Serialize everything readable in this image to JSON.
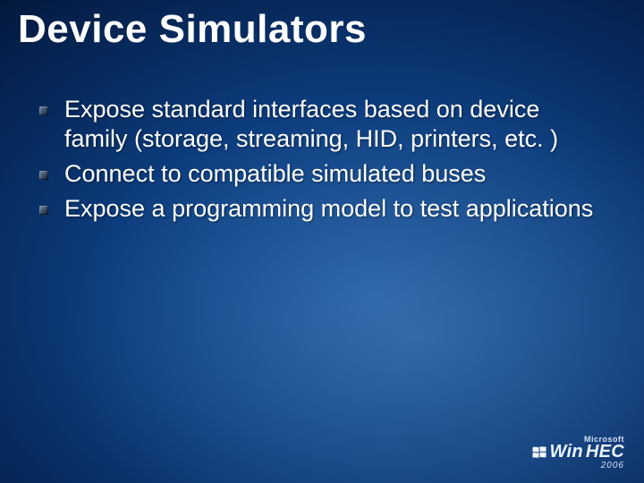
{
  "title": "Device Simulators",
  "bullets": [
    "Expose standard interfaces based on device family (storage, streaming, HID, printers, etc. )",
    "Connect to compatible simulated buses",
    "Expose a programming model to test applications"
  ],
  "footer": {
    "vendor": "Microsoft",
    "brand_prefix": "Win",
    "brand_suffix": "HEC",
    "year": "2006"
  }
}
